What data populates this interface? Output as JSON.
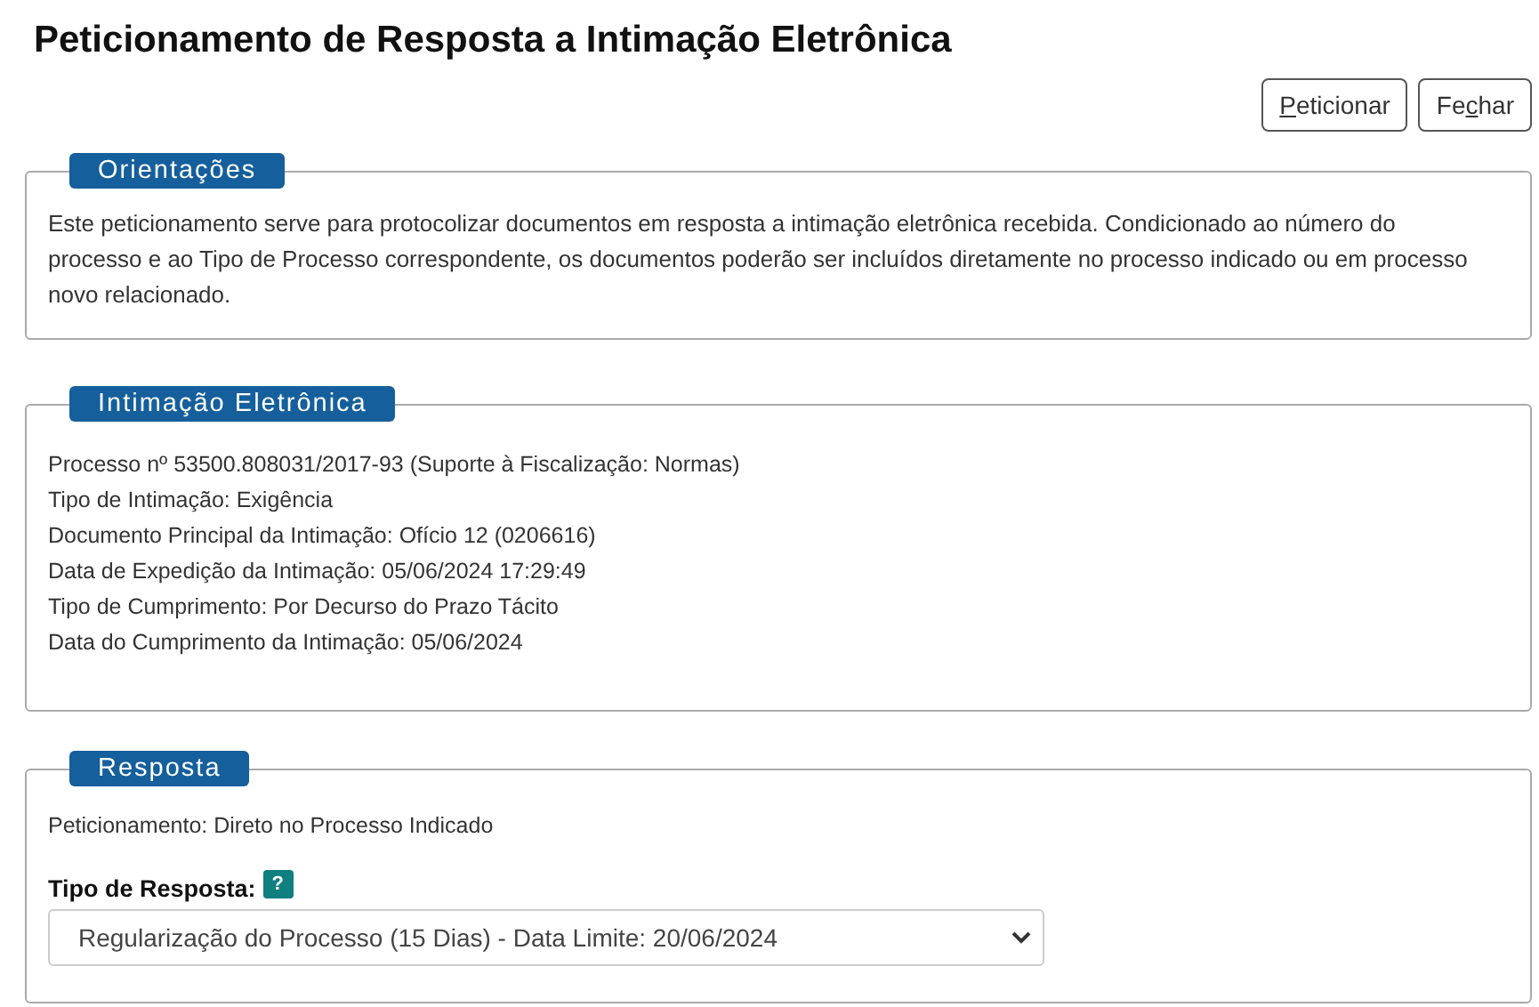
{
  "title": "Peticionamento de Resposta a Intimação Eletrônica",
  "buttons": [
    {
      "key": "P",
      "after": "eticionar"
    },
    {
      "before": "Fe",
      "key": "c",
      "after": "har"
    }
  ],
  "orientacoes": {
    "legend": "Orientações",
    "text": "Este peticionamento serve para protocolizar documentos em resposta a intimação eletrônica recebida. Condicionado ao número do processo e ao Tipo de Processo correspondente, os documentos poderão ser incluídos diretamente no processo indicado ou em processo novo relacionado."
  },
  "intimacao": {
    "legend": "Intimação Eletrônica",
    "lines": [
      "Processo nº 53500.808031/2017-93 (Suporte à Fiscalização: Normas)",
      "Tipo de Intimação: Exigência",
      "Documento Principal da Intimação: Ofício 12 (0206616)",
      "Data de Expedição da Intimação: 05/06/2024 17:29:49",
      "Tipo de Cumprimento: Por Decurso do Prazo Tácito",
      "Data do Cumprimento da Intimação: 05/06/2024"
    ]
  },
  "resposta": {
    "legend": "Resposta",
    "peticionamento": "Peticionamento: Direto no Processo Indicado",
    "field_label": "Tipo de Resposta:",
    "help": "?",
    "select_value": "Regularização do Processo (15 Dias) - Data Limite: 20/06/2024"
  }
}
